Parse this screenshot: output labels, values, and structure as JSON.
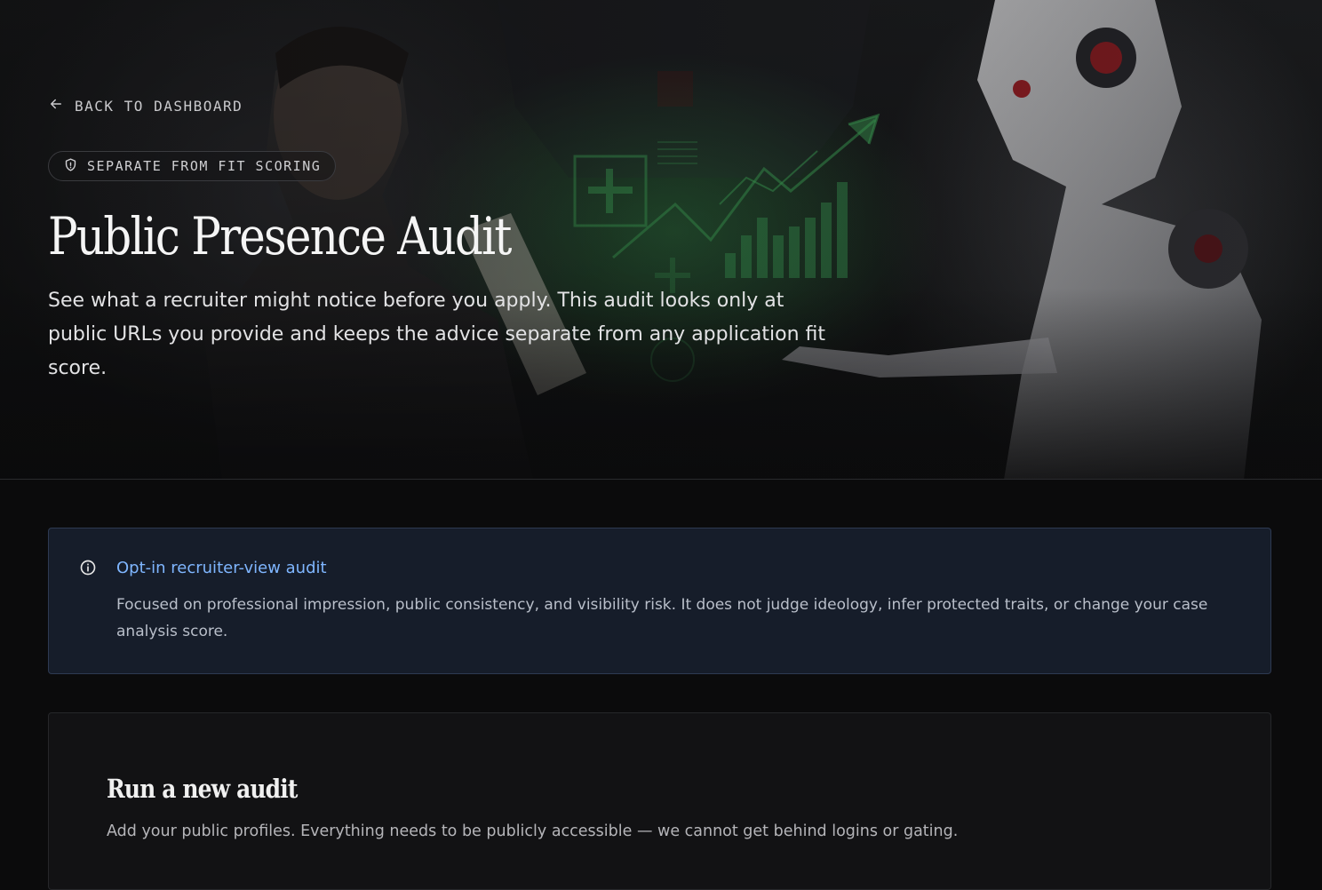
{
  "nav": {
    "back_label": "BACK TO DASHBOARD"
  },
  "hero": {
    "badge": "SEPARATE FROM FIT SCORING",
    "title": "Public Presence Audit",
    "subtitle": "See what a recruiter might notice before you apply. This audit looks only at public URLs you provide and keeps the advice separate from any application fit score."
  },
  "notice": {
    "title": "Opt-in recruiter-view audit",
    "body": "Focused on professional impression, public consistency, and visibility risk. It does not judge ideology, infer protected traits, or change your case analysis score."
  },
  "audit_panel": {
    "title": "Run a new audit",
    "description": "Add your public profiles. Everything needs to be publicly accessible — we cannot get behind logins or gating."
  },
  "icons": {
    "back": "arrow-left-icon",
    "badge": "shield-icon",
    "notice": "info-icon"
  },
  "colors": {
    "accent": "#7fb6ff",
    "notice_bg": "#161d2a",
    "chart_green": "#3fa95a"
  }
}
